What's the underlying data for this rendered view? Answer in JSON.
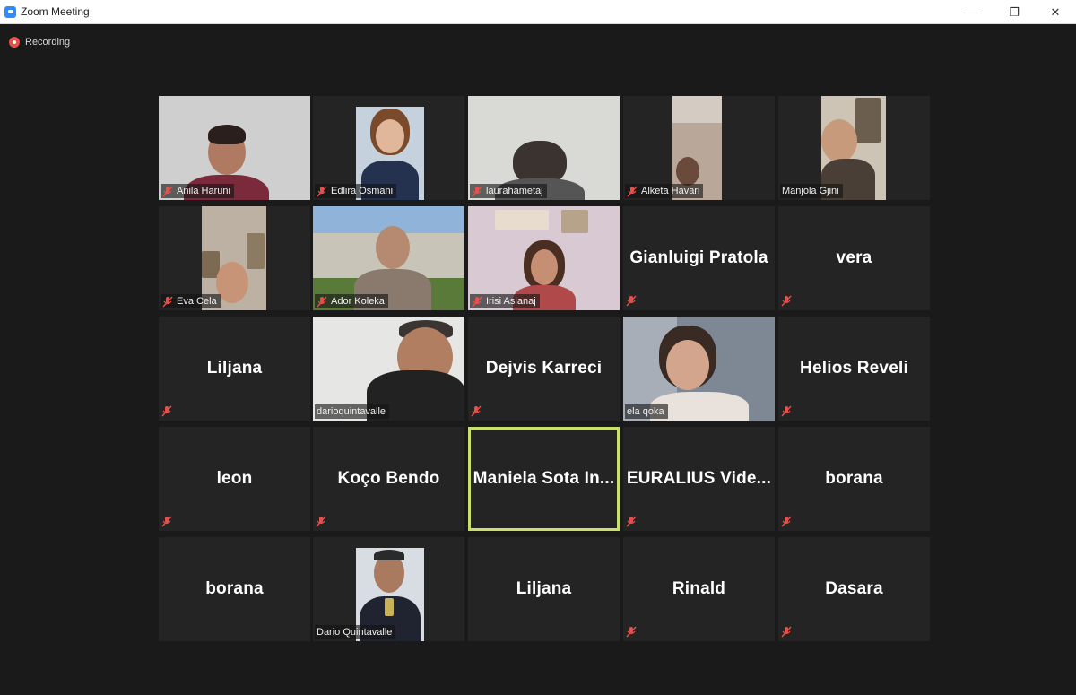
{
  "window": {
    "title": "Zoom Meeting",
    "minimize_glyph": "—",
    "maximize_glyph": "❐",
    "close_glyph": "✕"
  },
  "recording": {
    "label": "Recording",
    "color": "#e8504a"
  },
  "colors": {
    "active_speaker_border": "#c9e06a",
    "muted_icon": "#e8504a",
    "tile_bg": "#242424"
  },
  "participants": [
    {
      "name": "Anila Haruni",
      "video": true,
      "muted": true
    },
    {
      "name": "Edlira Osmani",
      "video": true,
      "muted": true
    },
    {
      "name": "laurahametaj",
      "video": true,
      "muted": true
    },
    {
      "name": "Alketa Havari",
      "video": true,
      "muted": true
    },
    {
      "name": "Manjola Gjini",
      "video": true,
      "muted": false
    },
    {
      "name": "Eva Cela",
      "video": true,
      "muted": true
    },
    {
      "name": "Ador Koleka",
      "video": true,
      "muted": true
    },
    {
      "name": "Irisi Aslanaj",
      "video": true,
      "muted": true
    },
    {
      "name": "Gianluigi Pratola",
      "video": false,
      "muted": true
    },
    {
      "name": "vera",
      "video": false,
      "muted": true
    },
    {
      "name": "Liljana",
      "video": false,
      "muted": true
    },
    {
      "name": "darioquintavalle",
      "video": true,
      "muted": false
    },
    {
      "name": "Dejvis Karreci",
      "video": false,
      "muted": true
    },
    {
      "name": "ela qoka",
      "video": true,
      "muted": false
    },
    {
      "name": "Helios Reveli",
      "video": false,
      "muted": true
    },
    {
      "name": "leon",
      "video": false,
      "muted": true
    },
    {
      "name": "Koço Bendo",
      "video": false,
      "muted": true
    },
    {
      "name": "Maniela Sota In...",
      "video": false,
      "muted": false,
      "active_speaker": true
    },
    {
      "name": "EURALIUS Vide...",
      "video": false,
      "muted": true
    },
    {
      "name": "borana",
      "video": false,
      "muted": true
    },
    {
      "name": "borana",
      "video": false,
      "muted": false
    },
    {
      "name": "Dario Quintavalle",
      "video": true,
      "muted": false
    },
    {
      "name": "Liljana",
      "video": false,
      "muted": false
    },
    {
      "name": "Rinald",
      "video": false,
      "muted": true
    },
    {
      "name": "Dasara",
      "video": false,
      "muted": true
    }
  ]
}
